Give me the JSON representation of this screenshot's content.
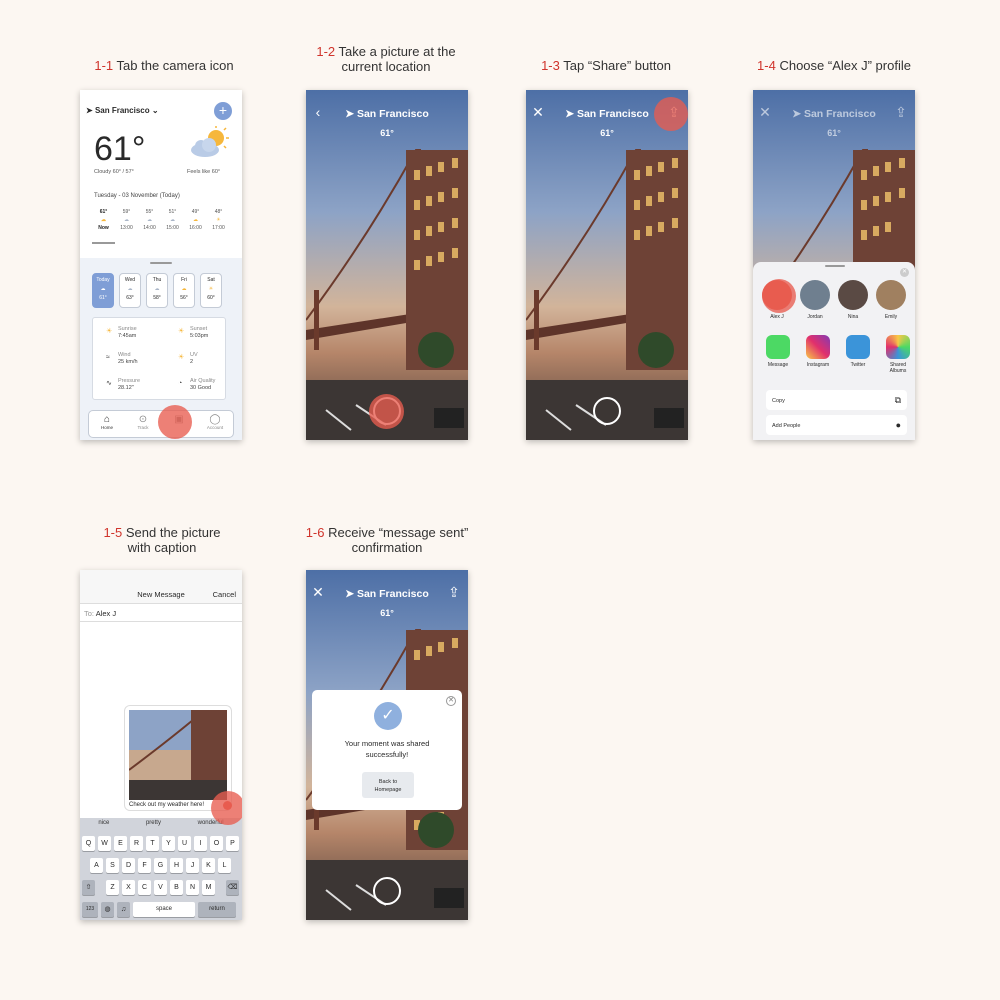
{
  "steps": [
    {
      "num": "1-1",
      "text": "Tab the camera icon"
    },
    {
      "num": "1-2",
      "text": "Take a picture at the",
      "text2": "current location"
    },
    {
      "num": "1-3",
      "text": "Tap “Share” button"
    },
    {
      "num": "1-4",
      "text": "Choose “Alex J” profile"
    },
    {
      "num": "1-5",
      "text": "Send the picture",
      "text2": "with caption"
    },
    {
      "num": "1-6",
      "text": "Receive “message sent”",
      "text2": "confirmation"
    }
  ],
  "weather": {
    "city": "San Francisco",
    "temp": "61°",
    "condition": "Cloudy 60° / 57°",
    "feels_like": "Feels like 60°",
    "date": "Tuesday - 03 November (Today)",
    "hours": [
      {
        "t": "61°",
        "h": "Now"
      },
      {
        "t": "59°",
        "h": "13:00"
      },
      {
        "t": "55°",
        "h": "14:00"
      },
      {
        "t": "51°",
        "h": "15:00"
      },
      {
        "t": "49°",
        "h": "16:00"
      },
      {
        "t": "48°",
        "h": "17:00"
      }
    ],
    "days": [
      {
        "d": "Today",
        "t": "61°"
      },
      {
        "d": "Wed",
        "t": "63°"
      },
      {
        "d": "Thu",
        "t": "58°"
      },
      {
        "d": "Fri",
        "t": "56°"
      },
      {
        "d": "Sat",
        "t": "60°"
      }
    ],
    "details": {
      "sunrise_label": "Sunrise",
      "sunrise": "7:45am",
      "sunset_label": "Sunset",
      "sunset": "5:03pm",
      "wind_label": "Wind",
      "wind": "25 km/h",
      "uv_label": "UV",
      "uv": "2",
      "pressure_label": "Pressure",
      "pressure": "28.12\"",
      "aq_label": "Air Quality",
      "aq": "30 Good"
    },
    "tabs": [
      "Home",
      "Track",
      "",
      "Account"
    ]
  },
  "share": {
    "people": [
      "Alex J",
      "Jordan",
      "Nina",
      "Emily"
    ],
    "apps": [
      "Message",
      "Instagram",
      "Twitter",
      "Shared Albums"
    ],
    "copy": "Copy",
    "add_people": "Add People"
  },
  "message": {
    "title": "New Message",
    "cancel": "Cancel",
    "to_label": "To:",
    "to": "Alex J",
    "caption": "Check out my weather here!",
    "suggestions": [
      "nice",
      "pretty",
      "wonderful"
    ],
    "row1": [
      "Q",
      "W",
      "E",
      "R",
      "T",
      "Y",
      "U",
      "I",
      "O",
      "P"
    ],
    "row2": [
      "A",
      "S",
      "D",
      "F",
      "G",
      "H",
      "J",
      "K",
      "L"
    ],
    "row3": [
      "Z",
      "X",
      "C",
      "V",
      "B",
      "N",
      "M"
    ],
    "num_key": "123",
    "space": "space",
    "return": "return"
  },
  "confirm": {
    "line1": "Your moment was shared",
    "line2": "successfully!",
    "btn1": "Back to",
    "btn2": "Homepage"
  },
  "colors": {
    "accent": "#d0342c",
    "tap": "#e85c50",
    "primary": "#7f9ed6"
  }
}
